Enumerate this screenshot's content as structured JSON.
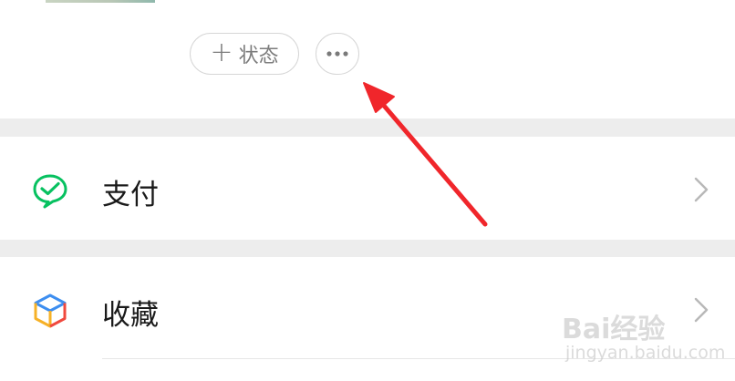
{
  "profile": {
    "status_button": {
      "plus": "+",
      "label": "状态"
    },
    "more_button": {
      "icon": "more-dots-icon"
    }
  },
  "menu": [
    {
      "label": "支付",
      "icon": "wechat-pay-icon",
      "icon_color": "#07c160"
    },
    {
      "label": "收藏",
      "icon": "favorites-cube-icon"
    }
  ],
  "annotation": {
    "arrow_color": "#f0262b"
  },
  "watermark": {
    "logo": "Bai经验",
    "site": "jingyan.baidu.com"
  }
}
